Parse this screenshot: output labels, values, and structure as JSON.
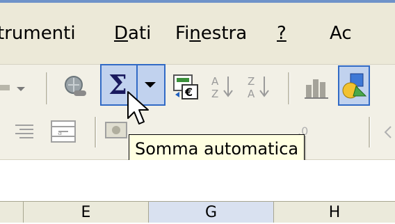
{
  "menu": {
    "items": [
      {
        "label": "trumenti",
        "mnemonic_index": -1
      },
      {
        "label": "Dati",
        "mnemonic_index": 0
      },
      {
        "label": "Finestra",
        "mnemonic_index": 2
      },
      {
        "label": "?",
        "mnemonic_index": 0
      },
      {
        "label": "Ac",
        "mnemonic_index": -1
      }
    ]
  },
  "toolbar": {
    "autosum_icon": "sigma-icon",
    "autosum_symbol": "Σ",
    "dropdown_icon": "dropdown-arrow-icon",
    "euro_icon": "euro-conversion-icon",
    "sort_asc_icon": "sort-ascending-icon",
    "sort_desc_icon": "sort-descending-icon",
    "chart_icon": "chart-wizard-icon",
    "drawing_icon": "drawing-icon",
    "hyperlink_icon": "hyperlink-icon"
  },
  "tooltip": {
    "text": "Somma automatica"
  },
  "sheet": {
    "column_headers": [
      "E",
      "G",
      "H"
    ],
    "selected_column": "G"
  },
  "colors": {
    "hover_fill": "#c1d2ee",
    "hover_border": "#316ac5",
    "tooltip_bg": "#ffffe1",
    "menubar_bg": "#ece9d8"
  }
}
